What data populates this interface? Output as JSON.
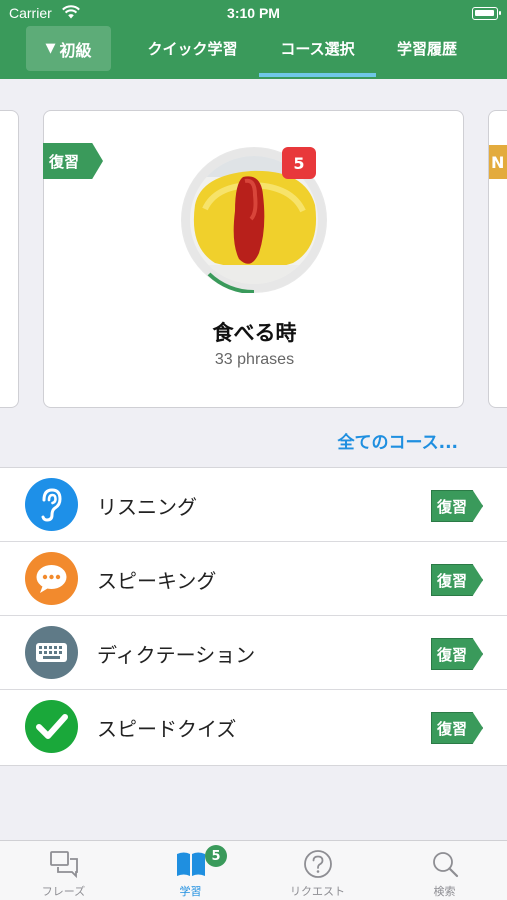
{
  "status": {
    "carrier": "Carrier",
    "time": "3:10 PM"
  },
  "header": {
    "level_label": "初級",
    "tabs": [
      {
        "label": "クイック学習"
      },
      {
        "label": "コース選択"
      },
      {
        "label": "学習履歴"
      }
    ],
    "active_tab": "コース選択"
  },
  "carousel": {
    "card": {
      "tag": "復習",
      "badge_count": "5",
      "title": "食べる時",
      "subtitle": "33 phrases",
      "progress": 0.1
    },
    "next_card_tag": "N"
  },
  "all_courses_link": "全てのコース...",
  "modes": [
    {
      "label": "リスニング",
      "review": "復習",
      "icon": "ear-icon",
      "color": "#1e90e8"
    },
    {
      "label": "スピーキング",
      "review": "復習",
      "icon": "speech-bubble-icon",
      "color": "#f28a2d"
    },
    {
      "label": "ディクテーション",
      "review": "復習",
      "icon": "keyboard-icon",
      "color": "#5f7a87"
    },
    {
      "label": "スピードクイズ",
      "review": "復習",
      "icon": "checkmark-icon",
      "color": "#1aa83a"
    }
  ],
  "tabbar": {
    "items": [
      {
        "label": "フレーズ",
        "icon": "chat-bubbles-icon"
      },
      {
        "label": "学習",
        "icon": "book-icon"
      },
      {
        "label": "リクエスト",
        "icon": "question-icon"
      },
      {
        "label": "検索",
        "icon": "search-icon"
      }
    ],
    "active": "学習",
    "study_badge": "5"
  },
  "colors": {
    "brand_green": "#3a9a5b",
    "accent_blue": "#1f8fe0",
    "badge_red": "#e8383b"
  }
}
